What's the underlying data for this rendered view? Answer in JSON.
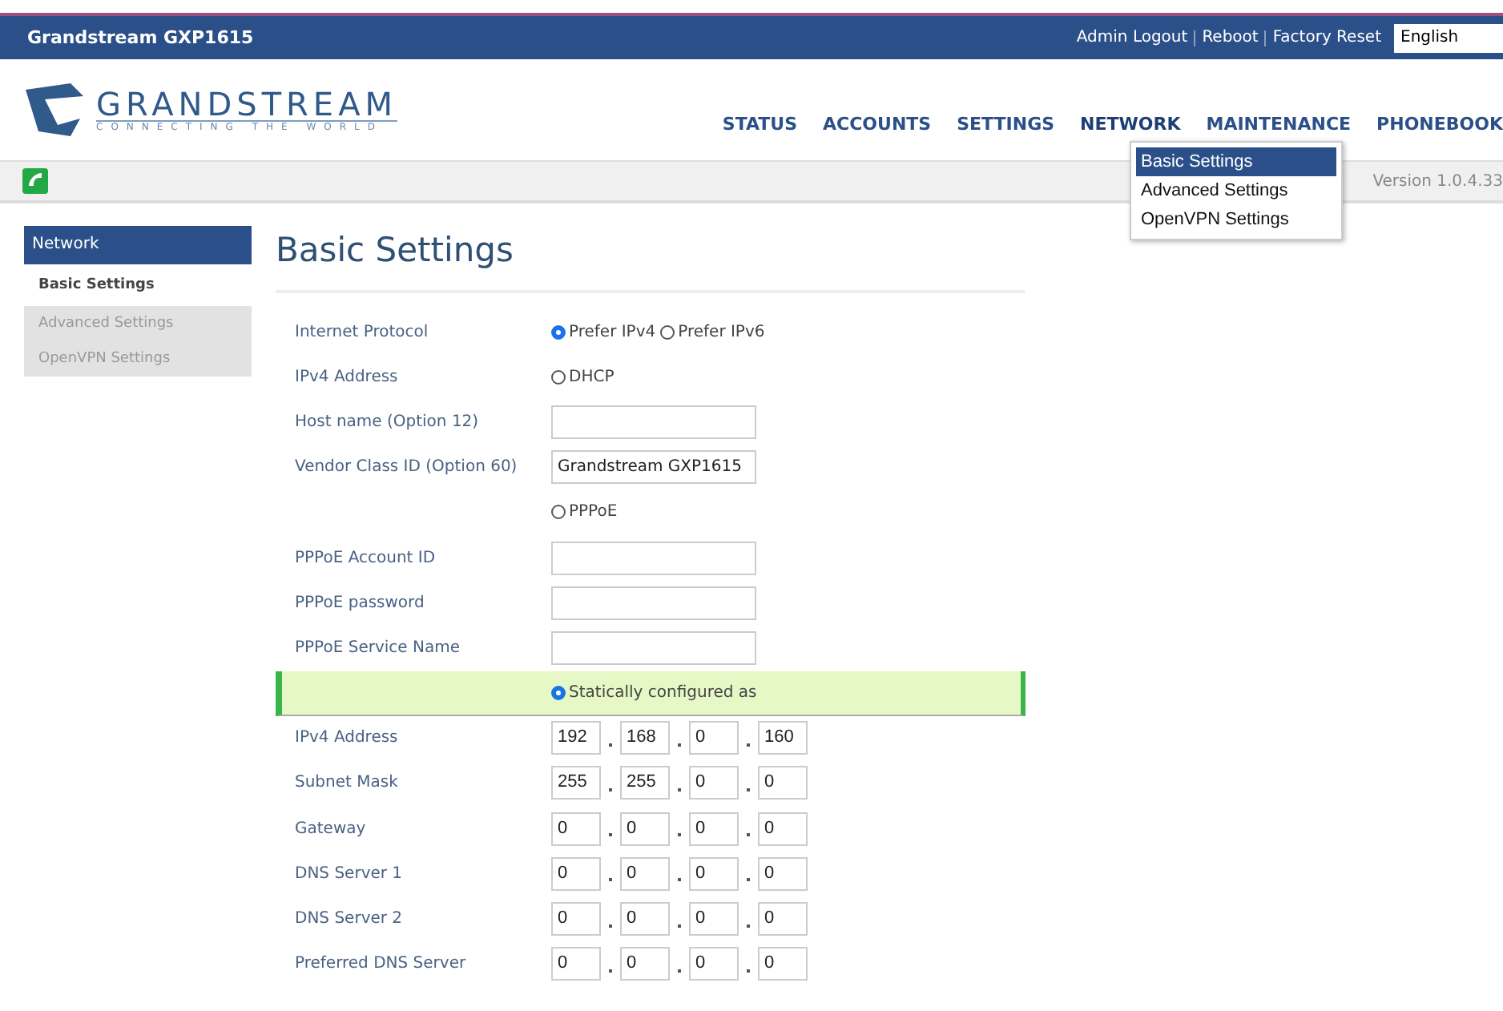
{
  "top_bar": {
    "title": "Grandstream GXP1615",
    "links": [
      "Admin Logout",
      "Reboot",
      "Factory Reset"
    ],
    "language": "English"
  },
  "logo": {
    "name": "GRANDSTREAM",
    "tagline": "CONNECTING THE WORLD"
  },
  "nav": [
    {
      "label": "STATUS",
      "selected": false
    },
    {
      "label": "ACCOUNTS",
      "selected": false
    },
    {
      "label": "SETTINGS",
      "selected": false
    },
    {
      "label": "NETWORK",
      "selected": true
    },
    {
      "label": "MAINTENANCE",
      "selected": false
    },
    {
      "label": "PHONEBOOK",
      "selected": false
    }
  ],
  "dropdown": [
    {
      "label": "Basic Settings",
      "selected": true
    },
    {
      "label": "Advanced Settings",
      "selected": false
    },
    {
      "label": "OpenVPN Settings",
      "selected": false
    }
  ],
  "version": "Version 1.0.4.33",
  "sidebar": {
    "heading": "Network",
    "items": [
      {
        "label": "Basic Settings",
        "selected": true
      },
      {
        "label": "Advanced Settings",
        "selected": false
      },
      {
        "label": "OpenVPN Settings",
        "selected": false
      }
    ]
  },
  "page_title": "Basic Settings",
  "rows": [
    {
      "kind": "radios",
      "label": "Internet Protocol",
      "options": [
        {
          "label": "Prefer IPv4",
          "selected": true
        },
        {
          "label": "Prefer IPv6",
          "selected": false
        }
      ]
    },
    {
      "kind": "radios",
      "label": "IPv4 Address",
      "options": [
        {
          "label": "DHCP",
          "selected": false
        }
      ]
    },
    {
      "kind": "text",
      "label": "Host name (Option 12)"
    },
    {
      "kind": "text",
      "label": "Vendor Class ID (Option 60)",
      "value": "Grandstream GXP1615"
    },
    {
      "kind": "radios",
      "options": [
        {
          "label": "PPPoE",
          "selected": false
        }
      ]
    },
    {
      "kind": "text",
      "label": "PPPoE Account ID"
    },
    {
      "kind": "text",
      "label": "PPPoE password"
    },
    {
      "kind": "text",
      "label": "PPPoE Service Name"
    },
    {
      "kind": "highlight",
      "options": [
        {
          "label": "Statically configured as",
          "selected": true
        }
      ]
    },
    {
      "kind": "ip",
      "label": "IPv4 Address",
      "octets": [
        "192",
        "168",
        "0",
        "160"
      ]
    },
    {
      "kind": "ip",
      "label": "Subnet Mask",
      "octets": [
        "255",
        "255",
        "0",
        "0"
      ]
    },
    {
      "kind": "ip",
      "label": "Gateway",
      "octets": [
        "0",
        "0",
        "0",
        "0"
      ]
    },
    {
      "kind": "ip",
      "label": "DNS Server 1",
      "octets": [
        "0",
        "0",
        "0",
        "0"
      ]
    },
    {
      "kind": "ip",
      "label": "DNS Server 2",
      "octets": [
        "0",
        "0",
        "0",
        "0"
      ]
    },
    {
      "kind": "ip",
      "label": "Preferred DNS Server",
      "octets": [
        "0",
        "0",
        "0",
        "0"
      ]
    }
  ]
}
